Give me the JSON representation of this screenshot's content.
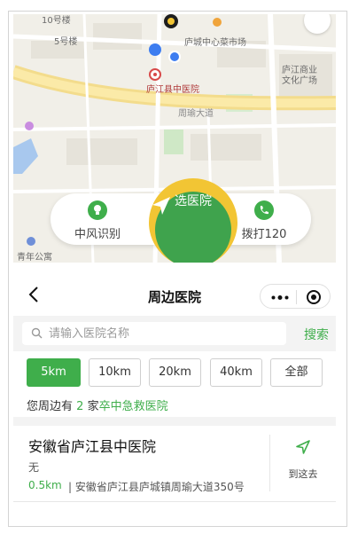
{
  "map": {
    "labels": {
      "bldg10": "10号楼",
      "bldg5": "5号楼",
      "market": "庐城中心菜市场",
      "plaza": "庐江商业\n文化广场",
      "hospital": "庐江县中医院",
      "road": "周瑜大道",
      "park": "青年公寓"
    },
    "actions": {
      "stroke_label": "中风识别",
      "select_label": "选医院",
      "call_label": "拨打120"
    },
    "colors": {
      "accent": "#3fae4b",
      "ring": "#f2c534"
    }
  },
  "header": {
    "title": "周边医院"
  },
  "search": {
    "placeholder": "请输入医院名称",
    "button_label": "搜索"
  },
  "filters": {
    "options": [
      "5km",
      "10km",
      "20km",
      "40km",
      "全部"
    ],
    "selected": "5km"
  },
  "summary": {
    "prefix": "您周边有",
    "count": "2",
    "unit": "家",
    "category": "卒中急救医院"
  },
  "hospitals": [
    {
      "name": "安徽省庐江县中医院",
      "phone": "无",
      "distance": "0.5km",
      "address": "| 安徽省庐江县庐城镇周瑜大道350号",
      "nav_label": "到这去"
    }
  ]
}
